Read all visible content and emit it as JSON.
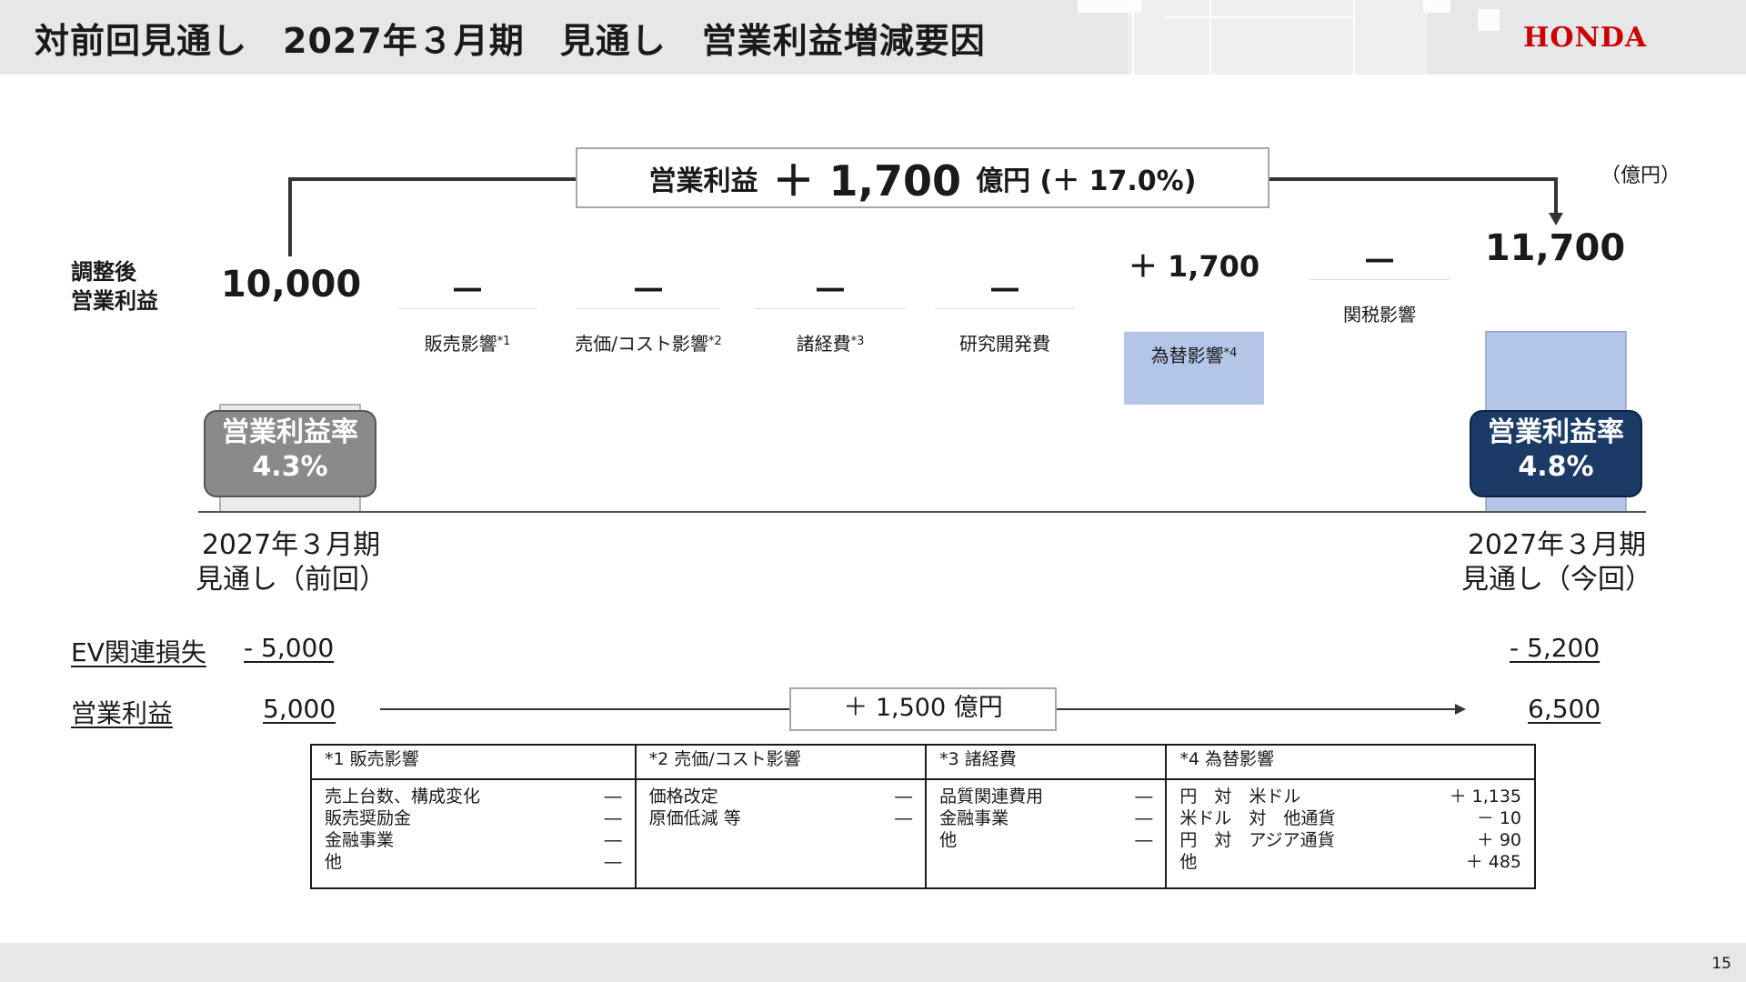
{
  "header": {
    "title": "対前回見通し　2027年３月期　見通し　営業利益増減要因",
    "brand": "HONDA"
  },
  "page_number": "15",
  "unit": "（億円）",
  "row_label": [
    "調整後",
    "営業利益"
  ],
  "summary": {
    "prefix": "営業利益",
    "value": "＋ 1,700",
    "suffix": "億円 (＋ 17.0%)"
  },
  "chart_data": {
    "type": "bar",
    "subtype": "waterfall",
    "unit": "億円",
    "categories": [
      "2027年３月期 見通し（前回）",
      "販売影響*1",
      "売価/コスト影響*2",
      "諸経費*3",
      "研究開発費",
      "為替影響*4",
      "関税影響",
      "2027年３月期 見通し（今回）"
    ],
    "values": [
      10000,
      0,
      0,
      0,
      0,
      1700,
      0,
      11700
    ],
    "value_labels": [
      "10,000",
      "―",
      "―",
      "―",
      "―",
      "＋ 1,700",
      "―",
      "11,700"
    ],
    "axis_floor": 7500,
    "colors": {
      "start": "#ebebeb",
      "change": "#b4c6e7",
      "end": "#b4c6e7"
    }
  },
  "bars": {
    "start_value": "10,000",
    "end_value": "11,700",
    "impacts": [
      {
        "label": "販売影響",
        "note": "*1",
        "value": "―"
      },
      {
        "label": "売価/コスト影響",
        "note": "*2",
        "value": "―"
      },
      {
        "label": "諸経費",
        "note": "*3",
        "value": "―"
      },
      {
        "label": "研究開発費",
        "note": "",
        "value": "―"
      },
      {
        "label": "為替影響",
        "note": "*4",
        "value": "＋ 1,700"
      },
      {
        "label": "関税影響",
        "note": "",
        "value": "―"
      }
    ]
  },
  "margins": {
    "left": {
      "label": "営業利益率",
      "value": "4.3%",
      "color": "#8a8a8a"
    },
    "right": {
      "label": "営業利益率",
      "value": "4.8%",
      "color": "#1c3a66"
    }
  },
  "periods": {
    "left": [
      "2027年３月期",
      "見通し（前回）"
    ],
    "right": [
      "2027年３月期",
      "見通し（今回）"
    ]
  },
  "ev_row": {
    "label": "EV関連損失",
    "left": "- 5,000",
    "right": "- 5,200"
  },
  "op_row": {
    "label": "営業利益",
    "left": "5,000",
    "right": "6,500",
    "delta": "＋ 1,500 億円"
  },
  "notes": [
    {
      "header": "*1 販売影響",
      "rows": [
        [
          "売上台数、構成変化",
          "―"
        ],
        [
          "販売奨励金",
          "―"
        ],
        [
          "金融事業",
          "―"
        ],
        [
          "他",
          "―"
        ]
      ]
    },
    {
      "header": "*2 売価/コスト影響",
      "rows": [
        [
          "価格改定",
          "―"
        ],
        [
          "原価低減 等",
          "―"
        ]
      ]
    },
    {
      "header": "*3 諸経費",
      "rows": [
        [
          "品質関連費用",
          "―"
        ],
        [
          "金融事業",
          "―"
        ],
        [
          "他",
          "―"
        ]
      ]
    },
    {
      "header": "*4 為替影響",
      "rows": [
        [
          "円　対　米ドル",
          "＋ 1,135"
        ],
        [
          "米ドル　対　他通貨",
          "－ 10"
        ],
        [
          "円　対　アジア通貨",
          "＋ 90"
        ],
        [
          "他",
          "＋ 485"
        ]
      ]
    }
  ]
}
